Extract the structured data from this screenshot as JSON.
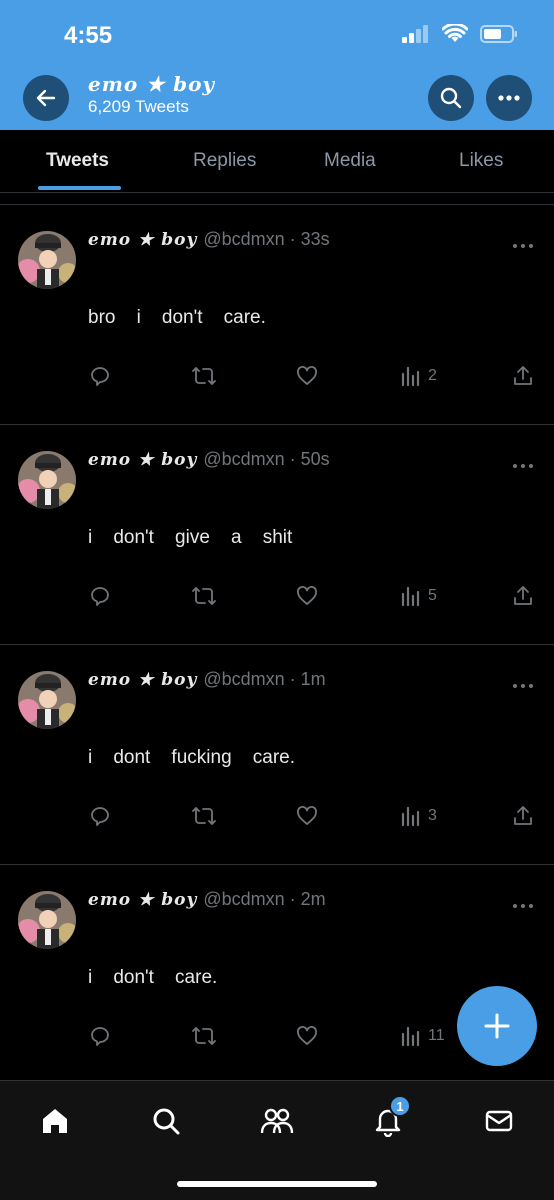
{
  "status_bar": {
    "time": "4:55"
  },
  "header": {
    "name": "emo ★ boy",
    "tweet_count": "6,209 Tweets",
    "back_icon": "arrow-left-icon",
    "search_icon": "search-icon",
    "more_icon": "more-horizontal-icon",
    "bg_color": "#4a9ee6"
  },
  "tabs": [
    {
      "label": "Tweets",
      "active": true
    },
    {
      "label": "Replies",
      "active": false
    },
    {
      "label": "Media",
      "active": false
    },
    {
      "label": "Likes",
      "active": false
    }
  ],
  "tweets": [
    {
      "name": "emo ★ boy",
      "meta": "@bcdmxn · 33s",
      "text": "bro    i    don't    care.",
      "views": "2"
    },
    {
      "name": "emo ★ boy",
      "meta": "@bcdmxn · 50s",
      "text": "i    don't    give    a    shit",
      "views": "5"
    },
    {
      "name": "emo ★ boy",
      "meta": "@bcdmxn · 1m",
      "text": "i    dont    fucking    care.",
      "views": "3"
    },
    {
      "name": "emo ★ boy",
      "meta": "@bcdmxn · 2m",
      "text": "i    don't    care.",
      "views": "11"
    }
  ],
  "fab": {
    "icon": "compose-plus-icon"
  },
  "bottom_nav": {
    "items": [
      "home-icon",
      "search-icon",
      "communities-icon",
      "notifications-icon",
      "messages-icon"
    ],
    "notification_badge": "1"
  },
  "colors": {
    "accent": "#4a9ee6",
    "background": "#000000",
    "muted": "#71767b"
  }
}
